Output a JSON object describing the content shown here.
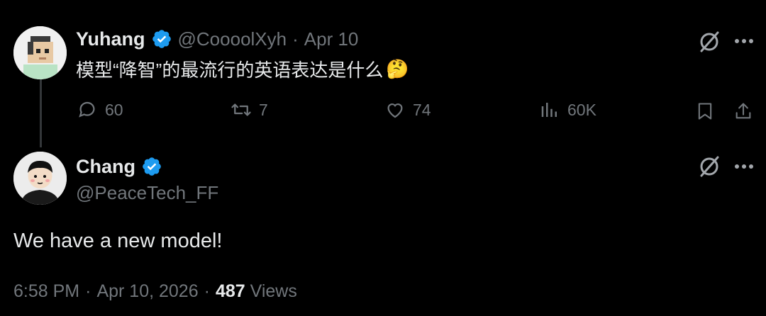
{
  "parent": {
    "display_name": "Yuhang",
    "handle": "@CoooolXyh",
    "separator": "·",
    "date": "Apr 10",
    "text": "模型“降智”的最流行的英语表达是什么",
    "emoji": "🤔",
    "actions": {
      "replies": "60",
      "reposts": "7",
      "likes": "74",
      "views": "60K"
    }
  },
  "main": {
    "display_name": "Chang",
    "handle": "@PeaceTech_FF",
    "text": "We have a new model!",
    "time": "6:58 PM",
    "separator": "·",
    "date": "Apr 10, 2026",
    "views_count": "487",
    "views_label": "Views"
  },
  "colors": {
    "background": "#000000",
    "text_primary": "#e7e9ea",
    "text_secondary": "#71767b",
    "verified_blue": "#1d9bf0",
    "thread_line": "#333639"
  },
  "icons": [
    "verified-badge-icon",
    "grok-icon",
    "more-icon",
    "reply-icon",
    "repost-icon",
    "like-icon",
    "views-icon",
    "bookmark-icon",
    "share-icon"
  ]
}
